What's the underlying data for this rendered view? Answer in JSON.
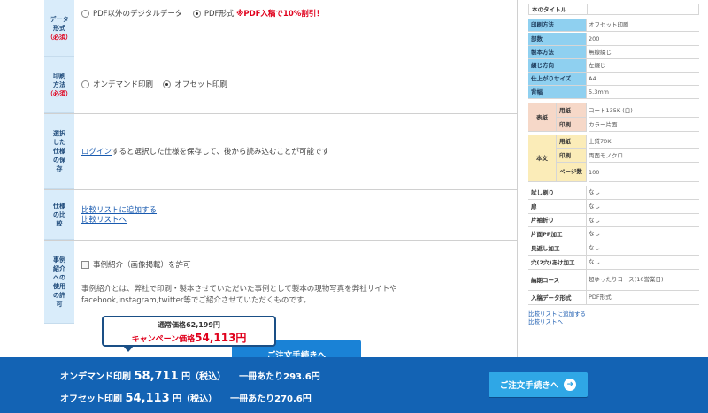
{
  "rows": {
    "format": {
      "label_parts": [
        "データ",
        "形式"
      ],
      "required": "（必須）",
      "option1": "PDF以外のデジタルデータ",
      "option2": "PDF形式",
      "promo": "※PDF入稿で10%割引！"
    },
    "method": {
      "label_parts": [
        "印刷",
        "方法"
      ],
      "required": "（必須）",
      "option1": "オンデマンド印刷",
      "option2": "オフセット印刷"
    },
    "save": {
      "label": "選択した仕様の保存",
      "link": "ログイン",
      "text": "すると選択した仕様を保存して、後から読み込むことが可能です"
    },
    "compare": {
      "label": "仕様の比較",
      "link1": "比較リストに追加する",
      "link2": "比較リストへ"
    },
    "case": {
      "label": "事例紹介への使用の許可",
      "checkbox": "事例紹介（画像掲載）を許可",
      "desc1": "事例紹介とは、弊社で印刷・製本させていただいた事例として製本の現物写真を弊社サイトや",
      "desc2": "facebook,instagram,twitter等でご紹介させていただくものです。"
    }
  },
  "spec": {
    "title_label": "本のタイトル",
    "title_value": "",
    "basic": [
      {
        "k": "印刷方法",
        "v": "オフセット印刷"
      },
      {
        "k": "部数",
        "v": "200"
      },
      {
        "k": "製本方法",
        "v": "無線綴じ"
      },
      {
        "k": "綴じ方向",
        "v": "左綴じ"
      },
      {
        "k": "仕上がりサイズ",
        "v": "A4"
      },
      {
        "k": "背幅",
        "v": "5.3mm"
      }
    ],
    "cover": {
      "group": "表紙",
      "rows": [
        {
          "k": "用紙",
          "v": "コート135K (白)"
        },
        {
          "k": "印刷",
          "v": "カラー片面"
        }
      ]
    },
    "body": {
      "group": "本文",
      "rows": [
        {
          "k": "用紙",
          "v": "上質70K"
        },
        {
          "k": "印刷",
          "v": "両面モノクロ"
        },
        {
          "k": "ページ数",
          "v": "100"
        }
      ]
    },
    "options": [
      {
        "k": "試し刷り",
        "v": "なし"
      },
      {
        "k": "扉",
        "v": "なし"
      },
      {
        "k": "片袖折り",
        "v": "なし"
      },
      {
        "k": "片面PP加工",
        "v": "なし"
      },
      {
        "k": "見返し加工",
        "v": "なし"
      },
      {
        "k": "穴(2穴)あけ加工",
        "v": "なし"
      },
      {
        "k": "納期コース",
        "v": "超ゆったりコース(10営業日)"
      },
      {
        "k": "入稿データ形式",
        "v": "PDF形式"
      }
    ],
    "link1": "比較リストに追加する",
    "link2": "比較リストへ"
  },
  "price_popup": {
    "old_label": "通常価格",
    "old_value": "62,199円",
    "now_label": "キャンペーン価格",
    "now_value": "54,113円"
  },
  "partial_button": "ご注文手続きへ",
  "bar": {
    "line1": {
      "name": "オンデマンド印刷",
      "price": "58,711",
      "unit": "円（税込）",
      "per": "一冊あたり293.6円"
    },
    "line2": {
      "name": "オフセット印刷",
      "price": "54,113",
      "unit": "円（税込）",
      "per": "一冊あたり270.6円"
    },
    "cta": "ご注文手続きへ"
  },
  "colors": {
    "accent": "#1363b4",
    "cta": "#2fa7e6",
    "alert": "#e0001c",
    "label_bg": "#d9ecfa"
  }
}
